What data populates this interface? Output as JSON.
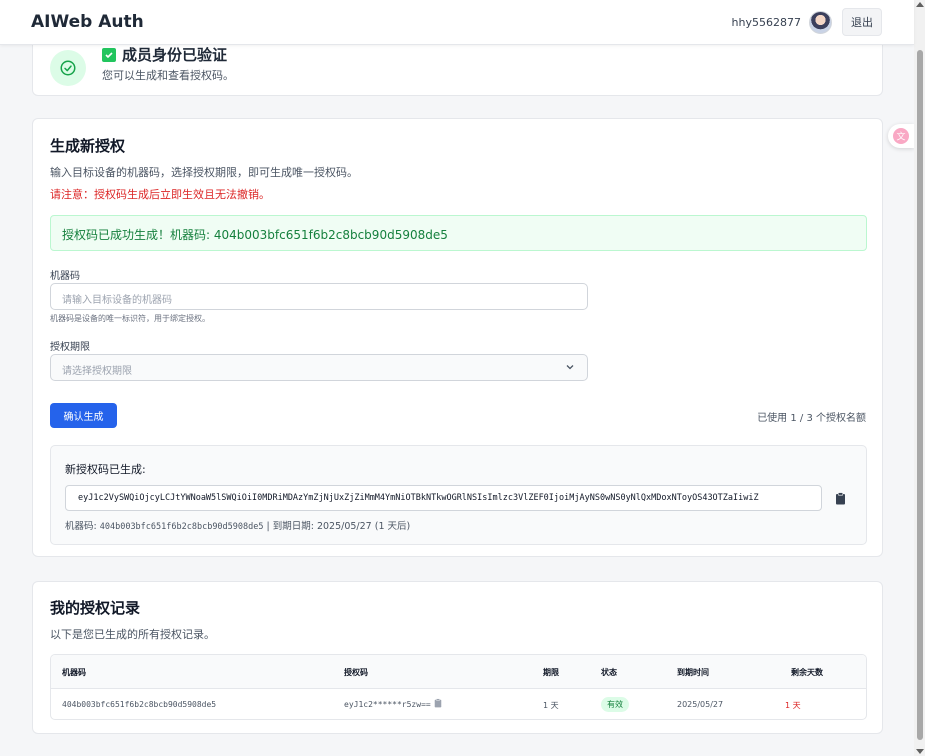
{
  "navbar": {
    "brand": "AIWeb Auth",
    "username": "hhy5562877",
    "logout_label": "退出"
  },
  "verification": {
    "title": "成员身份已验证",
    "subtitle": "您可以生成和查看授权码。"
  },
  "generate": {
    "title": "生成新授权",
    "description": "输入目标设备的机器码，选择授权期限，即可生成唯一授权码。",
    "warning": "请注意：授权码生成后立即生效且无法撤销。",
    "success_message": "授权码已成功生成！机器码: 404b003bfc651f6b2c8bcb90d5908de5",
    "machine_code_label": "机器码",
    "machine_code_placeholder": "请输入目标设备的机器码",
    "machine_code_hint": "机器码是设备的唯一标识符，用于绑定授权。",
    "period_label": "授权期限",
    "period_placeholder": "请选择授权期限",
    "submit_label": "确认生成",
    "quota_text": "已使用 1 / 3 个授权名额",
    "new_code": {
      "title": "新授权码已生成:",
      "code": "eyJ1c2VySWQiOjcyLCJtYWNoaW5lSWQiOiI0MDRiMDAzYmZjNjUxZjZiMmM4YmNiOTBkNTkwOGRlNSIsImlzc3VlZEF0IjoiMjAyNS0wNS0yNlQxMDoxNToyOS43OTZaIiwiZ",
      "meta_machine_label": "机器码: ",
      "meta_machine_value": "404b003bfc651f6b2c8bcb90d5908de5",
      "meta_expiry": " | 到期日期: 2025/05/27 (1 天后)"
    }
  },
  "records": {
    "title": "我的授权记录",
    "description": "以下是您已生成的所有授权记录。",
    "columns": [
      "机器码",
      "授权码",
      "期限",
      "状态",
      "到期时间",
      "剩余天数"
    ],
    "rows": [
      {
        "machine_code": "404b003bfc651f6b2c8bcb90d5908de5",
        "auth_code": "eyJ1c2******r5zw==",
        "period": "1 天",
        "status": "有效",
        "expires": "2025/05/27",
        "remaining": "1 天"
      }
    ]
  },
  "colors": {
    "primary": "#2563eb",
    "success": "#15803d",
    "success_bg": "#f0fdf4",
    "danger": "#dc2626"
  },
  "icons": {
    "verify": "check-circle-icon",
    "title_check": "checkbox-checked-icon",
    "select": "chevron-down-icon",
    "copy": "clipboard-icon",
    "floating": "translate-icon"
  }
}
